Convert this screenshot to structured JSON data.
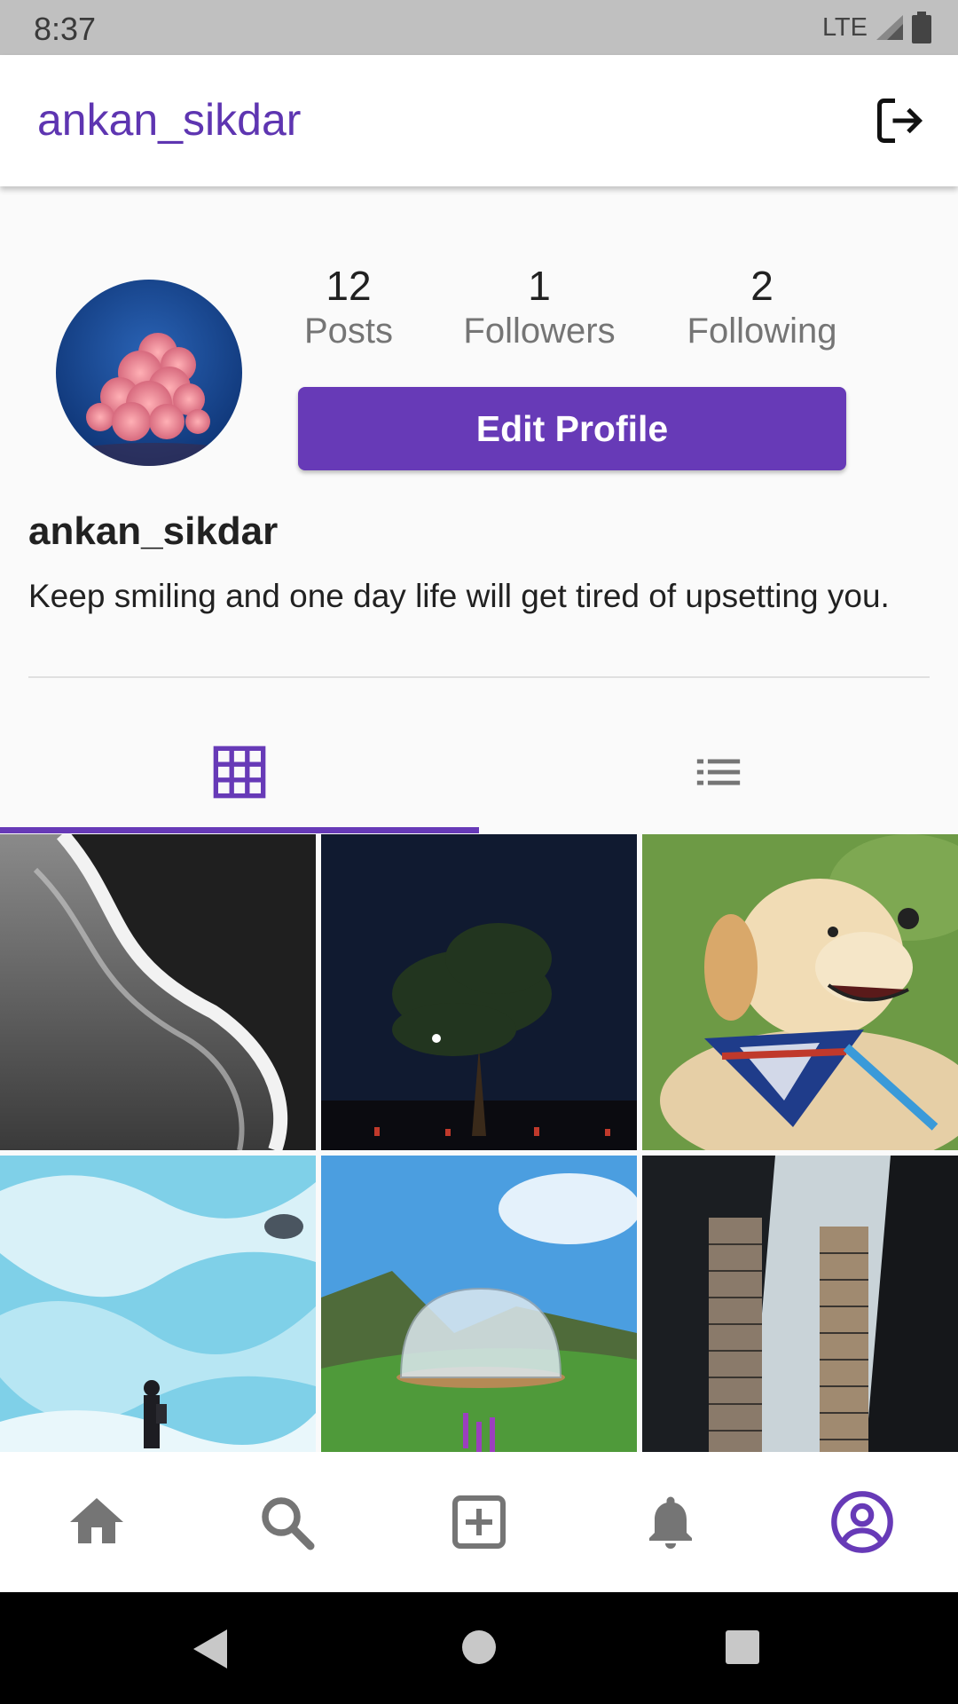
{
  "status_bar": {
    "time": "8:37",
    "network": "LTE"
  },
  "app_bar": {
    "title": "ankan_sikdar",
    "logout_icon": "logout-icon"
  },
  "profile": {
    "stats": [
      {
        "count": "12",
        "label": "Posts"
      },
      {
        "count": "1",
        "label": "Followers"
      },
      {
        "count": "2",
        "label": "Following"
      }
    ],
    "edit_button_label": "Edit Profile",
    "username": "ankan_sikdar",
    "bio": "Keep smiling and one day life will get tired of upsetting you."
  },
  "tabs": [
    {
      "icon": "grid-icon",
      "active": true
    },
    {
      "icon": "list-icon",
      "active": false
    }
  ],
  "bottom_nav": [
    {
      "icon": "home-icon"
    },
    {
      "icon": "search-icon"
    },
    {
      "icon": "add-box-icon"
    },
    {
      "icon": "bell-icon"
    },
    {
      "icon": "account-circle-icon",
      "active": true
    }
  ],
  "colors": {
    "accent": "#673ab7",
    "title": "#5e35b1",
    "icon_gray": "#757575"
  }
}
